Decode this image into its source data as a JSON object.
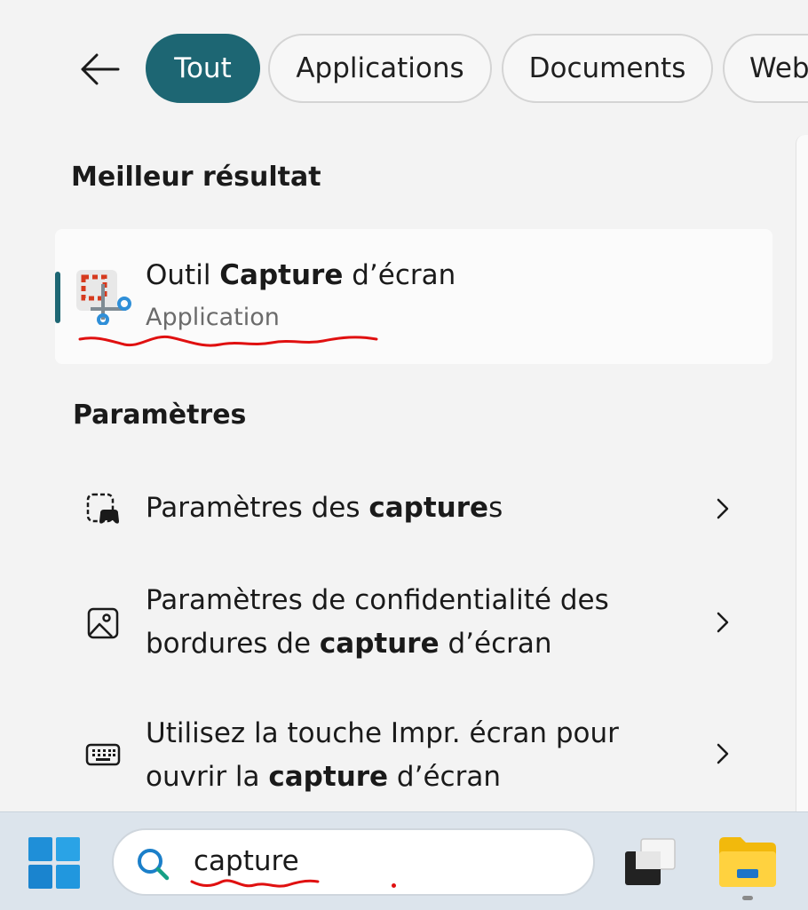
{
  "filters": {
    "back_icon": "back-arrow-icon",
    "tabs": [
      {
        "label": "Tout",
        "active": true
      },
      {
        "label": "Applications",
        "active": false
      },
      {
        "label": "Documents",
        "active": false
      },
      {
        "label": "Web",
        "active": false
      }
    ]
  },
  "best_match": {
    "section_title": "Meilleur résultat",
    "icon": "snipping-tool-icon",
    "name_before": "Outil ",
    "name_bold": "Capture",
    "name_after": " d’écran",
    "type": "Application"
  },
  "settings": {
    "section_title": "Paramètres",
    "items": [
      {
        "icon": "game-capture-icon",
        "line1_before": "Paramètres des ",
        "line1_bold": "capture",
        "line1_after": "s",
        "line2_before": "",
        "line2_bold": "",
        "line2_after": ""
      },
      {
        "icon": "picture-icon",
        "line1_before": "Paramètres de confidentialité des",
        "line1_bold": "",
        "line1_after": "",
        "line2_before": "bordures de ",
        "line2_bold": "capture",
        "line2_after": " d’écran"
      },
      {
        "icon": "keyboard-icon",
        "line1_before": "Utilisez la touche Impr. écran pour",
        "line1_bold": "",
        "line1_after": "",
        "line2_before": "ouvrir la ",
        "line2_bold": "capture",
        "line2_after": " d’écran"
      }
    ]
  },
  "taskbar": {
    "search_value": "capture",
    "icons": [
      "windows-start-icon",
      "search-icon",
      "task-view-icon",
      "file-explorer-icon"
    ]
  },
  "colors": {
    "accent": "#1d6673",
    "annotation_red": "#e01010"
  }
}
